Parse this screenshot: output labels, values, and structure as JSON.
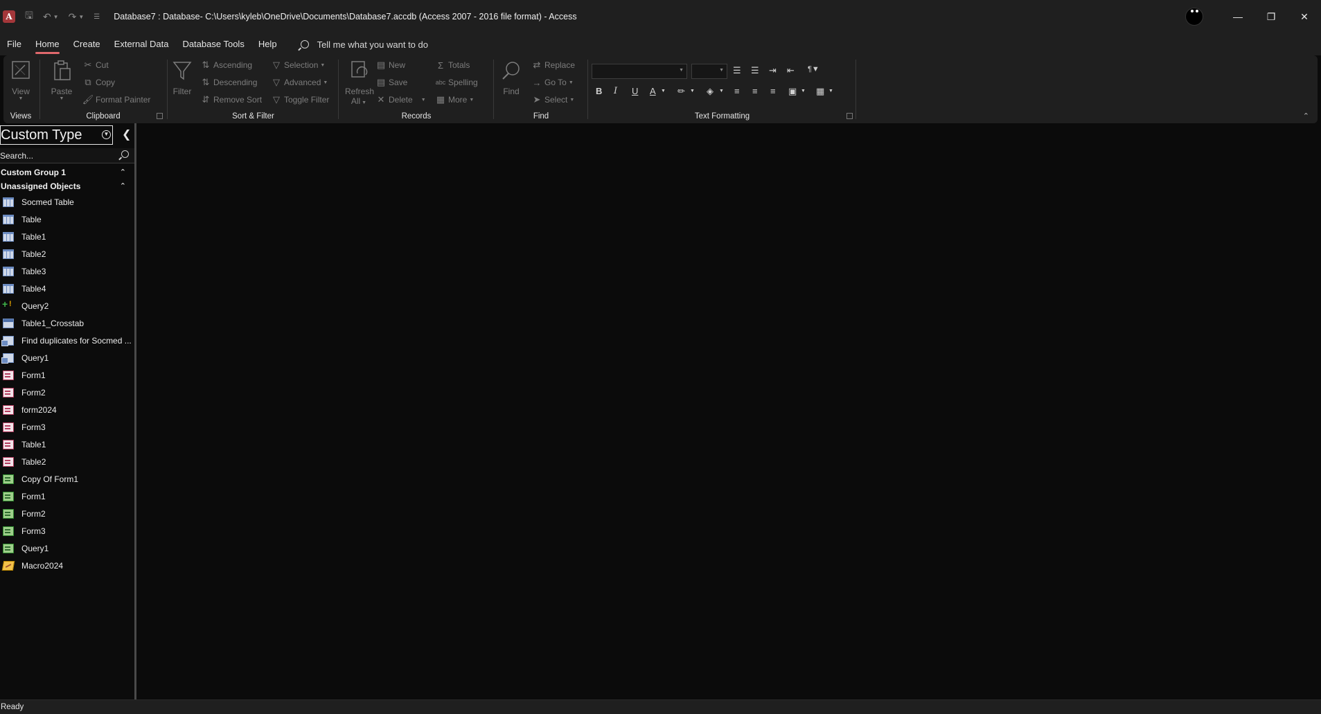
{
  "titlebar": {
    "title": "Database7 : Database- C:\\Users\\kyleb\\OneDrive\\Documents\\Database7.accdb (Access 2007 - 2016 file format)  -  Access",
    "app_icon_letter": "A",
    "app_icon_color": "#a4373a"
  },
  "menu": {
    "tabs": [
      {
        "label": "File"
      },
      {
        "label": "Home"
      },
      {
        "label": "Create"
      },
      {
        "label": "External Data"
      },
      {
        "label": "Database Tools"
      },
      {
        "label": "Help"
      }
    ],
    "active_tab": "Home",
    "tell_me": "Tell me what you want to do",
    "accent_color": "#e0686c"
  },
  "ribbon": {
    "views": {
      "label": "Views",
      "view": "View"
    },
    "clipboard": {
      "label": "Clipboard",
      "paste": "Paste",
      "cut": "Cut",
      "copy": "Copy",
      "format_painter": "Format Painter"
    },
    "sort_filter": {
      "label": "Sort & Filter",
      "filter": "Filter",
      "ascending": "Ascending",
      "descending": "Descending",
      "remove_sort": "Remove Sort",
      "selection": "Selection",
      "advanced": "Advanced",
      "toggle_filter": "Toggle Filter"
    },
    "records": {
      "label": "Records",
      "refresh_all_1": "Refresh",
      "refresh_all_2": "All",
      "new": "New",
      "save": "Save",
      "delete": "Delete",
      "totals": "Totals",
      "spelling": "Spelling",
      "more": "More"
    },
    "find": {
      "label": "Find",
      "find": "Find",
      "replace": "Replace",
      "go_to": "Go To",
      "select": "Select"
    },
    "text_formatting": {
      "label": "Text Formatting",
      "bold": "B",
      "italic": "I",
      "underline": "U",
      "font_color": "A"
    }
  },
  "nav": {
    "header": "Custom Type",
    "search_placeholder": "Search...",
    "groups": [
      {
        "label": "Custom Group 1"
      },
      {
        "label": "Unassigned Objects"
      }
    ],
    "items": [
      {
        "label": "Socmed Table",
        "icon": "table-icon"
      },
      {
        "label": "Table",
        "icon": "table-icon"
      },
      {
        "label": "Table1",
        "icon": "table-icon"
      },
      {
        "label": "Table2",
        "icon": "table-icon"
      },
      {
        "label": "Table3",
        "icon": "table-icon"
      },
      {
        "label": "Table4",
        "icon": "table-icon"
      },
      {
        "label": "Query2",
        "icon": "append-query-icon"
      },
      {
        "label": "Table1_Crosstab",
        "icon": "crosstab-query-icon"
      },
      {
        "label": "Find duplicates for Socmed ...",
        "icon": "select-query-icon"
      },
      {
        "label": "Query1",
        "icon": "select-query-icon"
      },
      {
        "label": "Form1",
        "icon": "form-icon"
      },
      {
        "label": "Form2",
        "icon": "form-icon"
      },
      {
        "label": "form2024",
        "icon": "form-icon"
      },
      {
        "label": "Form3",
        "icon": "form-icon"
      },
      {
        "label": "Table1",
        "icon": "form-icon"
      },
      {
        "label": "Table2",
        "icon": "form-icon"
      },
      {
        "label": "Copy Of Form1",
        "icon": "report-icon"
      },
      {
        "label": "Form1",
        "icon": "report-icon"
      },
      {
        "label": "Form2",
        "icon": "report-icon"
      },
      {
        "label": "Form3",
        "icon": "report-icon"
      },
      {
        "label": "Query1",
        "icon": "report-icon"
      },
      {
        "label": "Macro2024",
        "icon": "macro-icon"
      }
    ]
  },
  "status": {
    "text": "Ready"
  }
}
